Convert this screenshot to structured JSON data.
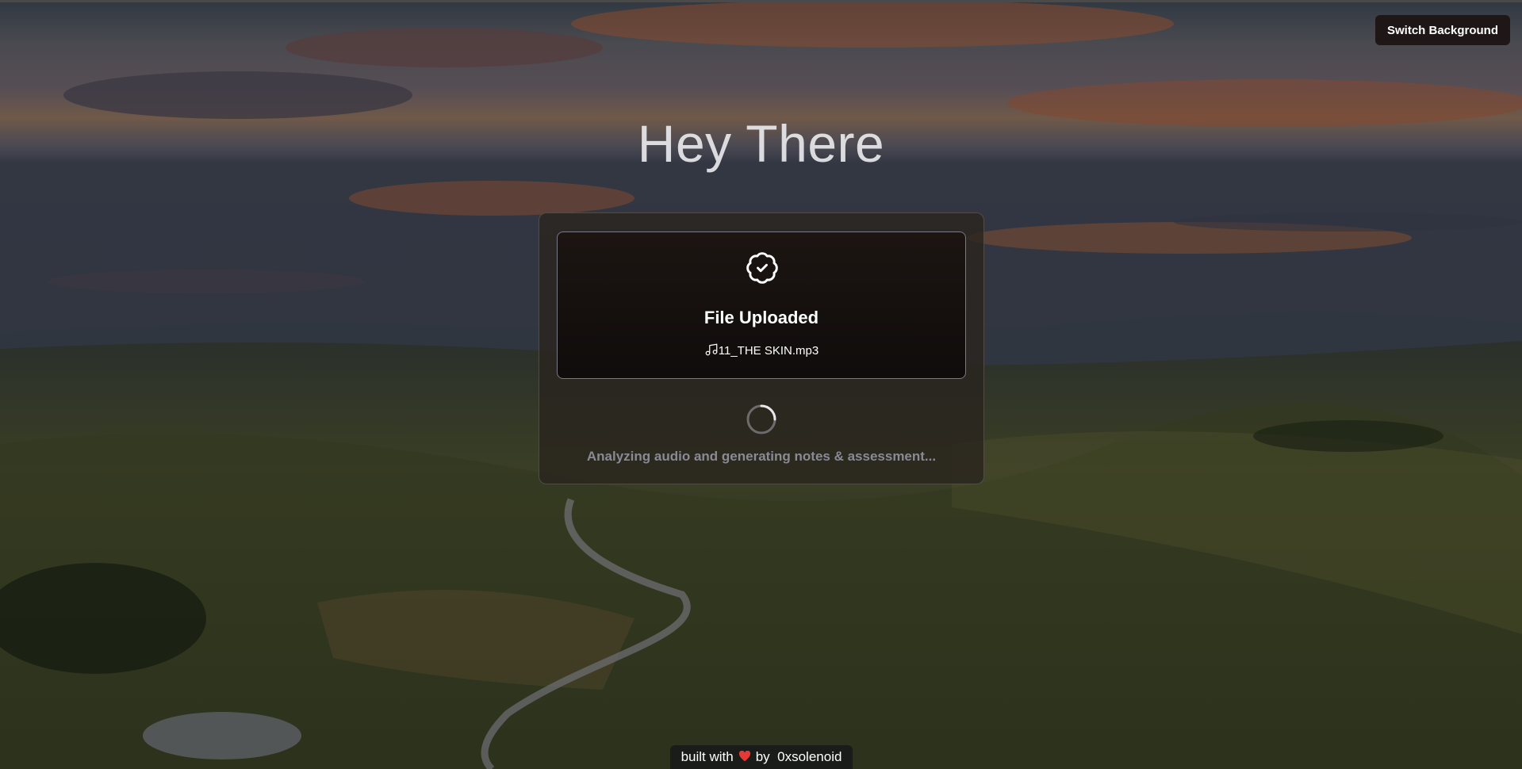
{
  "header": {
    "switch_background_label": "Switch Background"
  },
  "main": {
    "title": "Hey There"
  },
  "upload_card": {
    "status_title": "File Uploaded",
    "status_icon": "badge-check-icon",
    "file_icon": "music-note-icon",
    "file_name": "11_THE SKIN.mp3",
    "spinner_icon": "loading-spinner-icon",
    "analysis_text": "Analyzing audio and generating notes & assessment..."
  },
  "footer": {
    "prefix": "built with",
    "heart_icon": "heart-icon",
    "heart_color": "#e53935",
    "by_text": "by",
    "author": "0xsolenoid"
  },
  "colors": {
    "card_bg": "#2a241e",
    "analysis_text_color": "#8a8a94",
    "button_bg": "#1c1412"
  }
}
